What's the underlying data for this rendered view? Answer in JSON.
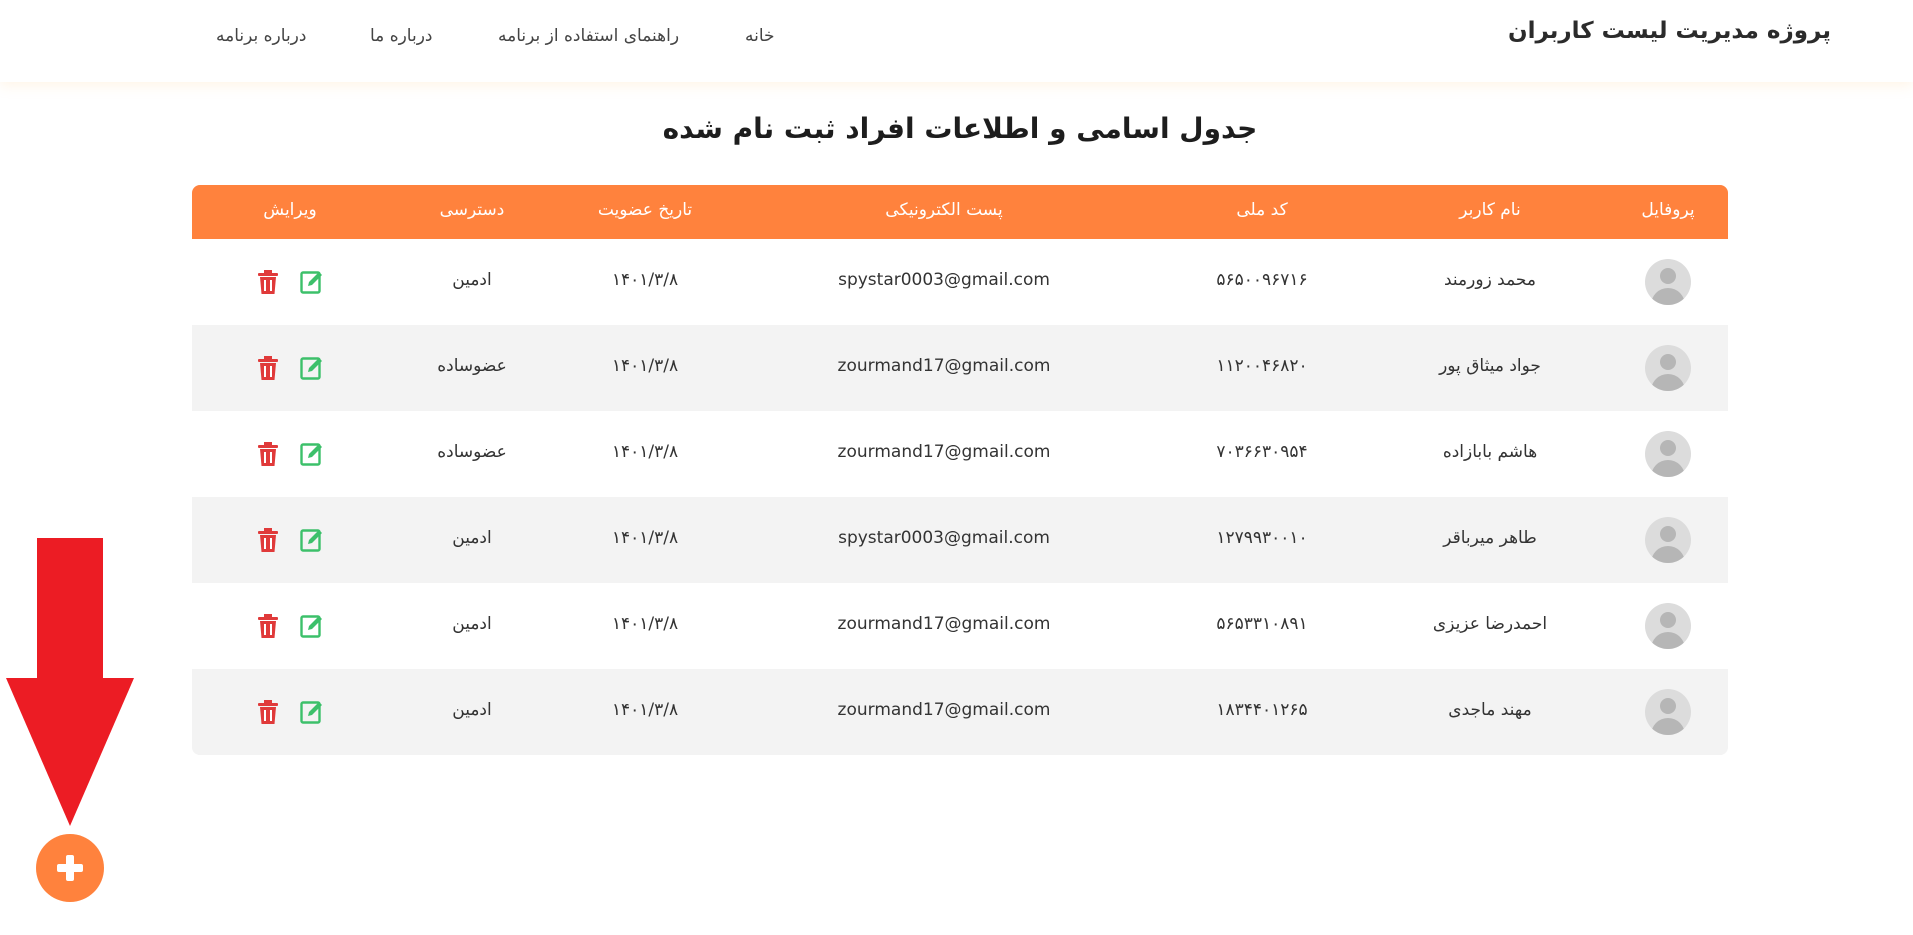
{
  "navbar": {
    "brand": "پروژه مدیریت لیست کاربران",
    "links": [
      "خانه",
      "راهنمای استفاده از برنامه",
      "درباره ما",
      "درباره برنامه"
    ]
  },
  "page_title": "جدول اسامی و اطلاعات افراد ثبت نام شده",
  "table": {
    "headers": [
      "پروفایل",
      "نام کاربر",
      "کد ملی",
      "پست الکترونیکی",
      "تاریخ عضویت",
      "دسترسی",
      "ویرایش"
    ],
    "rows": [
      {
        "name": "محمد زورمند",
        "national_id": "۵۶۵۰۰۹۶۷۱۶",
        "email": "spystar0003@gmail.com",
        "date": "۱۴۰۱/۳/۸",
        "access": "ادمین"
      },
      {
        "name": "جواد میثاق پور",
        "national_id": "۱۱۲۰۰۴۶۸۲۰",
        "email": "zourmand17@gmail.com",
        "date": "۱۴۰۱/۳/۸",
        "access": "عضوساده"
      },
      {
        "name": "هاشم بابازاده",
        "national_id": "۷۰۳۶۶۳۰۹۵۴",
        "email": "zourmand17@gmail.com",
        "date": "۱۴۰۱/۳/۸",
        "access": "عضوساده"
      },
      {
        "name": "طاهر میرباقر",
        "national_id": "۱۲۷۹۹۳۰۰۱۰",
        "email": "spystar0003@gmail.com",
        "date": "۱۴۰۱/۳/۸",
        "access": "ادمین"
      },
      {
        "name": "احمدرضا عزیزی",
        "national_id": "۵۶۵۳۳۱۰۸۹۱",
        "email": "zourmand17@gmail.com",
        "date": "۱۴۰۱/۳/۸",
        "access": "ادمین"
      },
      {
        "name": "مهند ماجدی",
        "national_id": "۱۸۳۴۴۰۱۲۶۵",
        "email": "zourmand17@gmail.com",
        "date": "۱۴۰۱/۳/۸",
        "access": "ادمین"
      }
    ]
  },
  "icons": {
    "edit": "edit-icon",
    "delete": "trash-icon",
    "add": "plus-icon",
    "arrow": "arrow-down-icon",
    "avatar": "user-avatar-icon"
  },
  "colors": {
    "accent": "#ff823d",
    "edit": "#3cc06a",
    "delete": "#e03a3a",
    "arrow": "#ec1c24"
  }
}
